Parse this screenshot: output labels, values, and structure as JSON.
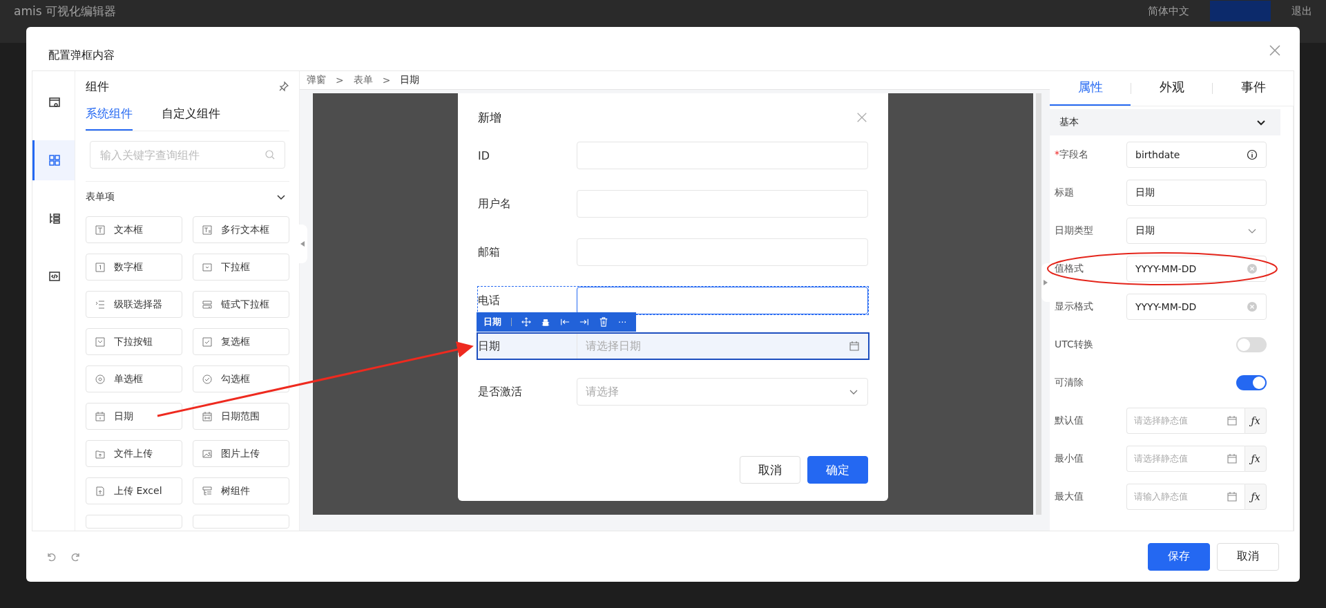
{
  "background": {
    "app_title": "amis 可视化编辑器",
    "language": "简体中文",
    "exit": "退出"
  },
  "dialog": {
    "title": "配置弹框内容"
  },
  "side_nav": [
    {
      "kind": "settings",
      "selected": false
    },
    {
      "kind": "components",
      "selected": true
    },
    {
      "kind": "outline",
      "selected": false
    },
    {
      "kind": "code",
      "selected": false
    }
  ],
  "component_panel": {
    "title": "组件",
    "tabs": [
      {
        "label": "系统组件",
        "selected": true
      },
      {
        "label": "自定义组件",
        "selected": false
      }
    ],
    "search": {
      "placeholder": "输入关键字查询组件"
    },
    "group": {
      "title": "表单项",
      "expanded": true
    },
    "items": [
      {
        "label": "文本框",
        "kind": "text"
      },
      {
        "label": "多行文本框",
        "kind": "textarea"
      },
      {
        "label": "数字框",
        "kind": "number"
      },
      {
        "label": "下拉框",
        "kind": "select"
      },
      {
        "label": "级联选择器",
        "kind": "cascader"
      },
      {
        "label": "链式下拉框",
        "kind": "chained"
      },
      {
        "label": "下拉按钮",
        "kind": "dropdown"
      },
      {
        "label": "复选框",
        "kind": "checkboxes"
      },
      {
        "label": "单选框",
        "kind": "radio"
      },
      {
        "label": "勾选框",
        "kind": "checkbox"
      },
      {
        "label": "日期",
        "kind": "date"
      },
      {
        "label": "日期范围",
        "kind": "daterange"
      },
      {
        "label": "文件上传",
        "kind": "file"
      },
      {
        "label": "图片上传",
        "kind": "image"
      },
      {
        "label": "上传 Excel",
        "kind": "excel"
      },
      {
        "label": "树组件",
        "kind": "tree"
      }
    ]
  },
  "breadcrumb": {
    "separator": ">",
    "items": [
      "弹窗",
      "表单",
      "日期"
    ]
  },
  "form_dialog": {
    "title": "新增",
    "fields": [
      {
        "label": "ID",
        "kind": "input",
        "selected": false,
        "hovered": false
      },
      {
        "label": "用户名",
        "kind": "input",
        "selected": false,
        "hovered": false
      },
      {
        "label": "邮箱",
        "kind": "input",
        "selected": false,
        "hovered": false
      },
      {
        "label": "电话",
        "kind": "input",
        "selected": false,
        "hovered": true
      },
      {
        "label": "日期",
        "kind": "date",
        "placeholder": "请选择日期",
        "selected": true,
        "hovered": false,
        "toolbar_label": "日期",
        "toolbar_more": "···"
      },
      {
        "label": "是否激活",
        "kind": "select",
        "placeholder": "请选择",
        "selected": false,
        "hovered": false
      }
    ],
    "buttons": [
      {
        "label": "取消",
        "primary": false
      },
      {
        "label": "确定",
        "primary": true
      }
    ]
  },
  "properties": {
    "tabs": [
      {
        "label": "属性",
        "selected": true
      },
      {
        "label": "外观",
        "selected": false
      },
      {
        "label": "事件",
        "selected": false
      }
    ],
    "section": {
      "title": "基本",
      "expanded": true
    },
    "rows": [
      {
        "label": "字段名",
        "required_mark": "*",
        "kind": "text-info",
        "value": "birthdate"
      },
      {
        "label": "标题",
        "kind": "text",
        "value": "日期"
      },
      {
        "label": "日期类型",
        "kind": "select",
        "value": "日期"
      },
      {
        "label": "值格式",
        "kind": "text-clear",
        "value": "YYYY-MM-DD"
      },
      {
        "label": "显示格式",
        "kind": "text-clear",
        "value": "YYYY-MM-DD"
      },
      {
        "label": "UTC转换",
        "kind": "switch",
        "on": false
      },
      {
        "label": "可清除",
        "kind": "switch",
        "on": true
      },
      {
        "label": "默认值",
        "kind": "date-formula",
        "placeholder": "请选择静态值",
        "formula": "ƒx"
      },
      {
        "label": "最小值",
        "kind": "date-formula",
        "placeholder": "请选择静态值",
        "formula": "ƒx"
      },
      {
        "label": "最大值",
        "kind": "date-formula",
        "placeholder": "请输入静态值",
        "formula": "ƒx"
      }
    ]
  },
  "footer": {
    "buttons": [
      {
        "label": "保存",
        "primary": true
      },
      {
        "label": "取消",
        "primary": false
      }
    ]
  }
}
